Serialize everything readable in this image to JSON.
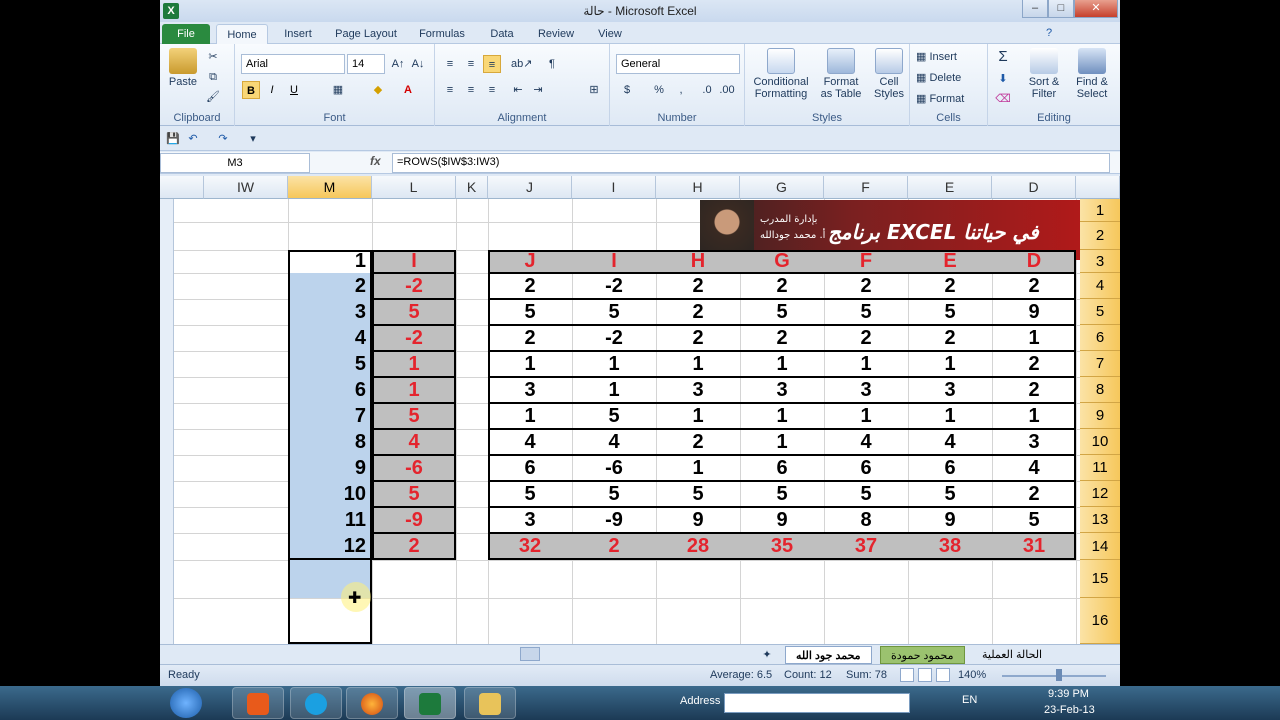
{
  "window": {
    "title": "حالة - Microsoft Excel",
    "app_icon": "X",
    "min_label": "–",
    "max_label": "□",
    "close_label": "✕"
  },
  "tabs": [
    "File",
    "Home",
    "Insert",
    "Page Layout",
    "Formulas",
    "Data",
    "Review",
    "View"
  ],
  "ribbon": {
    "clipboard": {
      "label": "Clipboard",
      "paste": "Paste"
    },
    "font": {
      "label": "Font",
      "name": "Arial",
      "size": "14",
      "bold": "B",
      "italic": "I",
      "underline": "U"
    },
    "alignment": {
      "label": "Alignment"
    },
    "number": {
      "label": "Number",
      "format": "General",
      "currency": "$",
      "percent": "%",
      "comma": ","
    },
    "styles": {
      "label": "Styles",
      "conditional": [
        "Conditional",
        "Formatting"
      ],
      "format_table": [
        "Format",
        "as Table"
      ],
      "cell_styles": [
        "Cell",
        "Styles"
      ]
    },
    "cells": {
      "label": "Cells",
      "insert": "Insert",
      "delete": "Delete",
      "format": "Format"
    },
    "editing": {
      "label": "Editing",
      "sort": [
        "Sort &",
        "Filter"
      ],
      "find": [
        "Find &",
        "Select"
      ]
    }
  },
  "formula_bar": {
    "name_box": "M3",
    "fx": "fx",
    "formula": "=ROWS($IW$3:IW3)"
  },
  "columns": [
    "IW",
    "M",
    "L",
    "K",
    "J",
    "I",
    "H",
    "G",
    "F",
    "E",
    "D"
  ],
  "rows": [
    "1",
    "2",
    "3",
    "4",
    "5",
    "6",
    "7",
    "8",
    "9",
    "10",
    "11",
    "12",
    "13",
    "14",
    "15",
    "16"
  ],
  "banner_text": "برنامج EXCEL في حياتنا",
  "banner_sub": "بإدارة المدرب",
  "banner_name": "أ. محمد جودالله",
  "table": {
    "headers": [
      "J",
      "I",
      "H",
      "G",
      "F",
      "E",
      "D"
    ],
    "data": [
      [
        "2",
        "-2",
        "2",
        "2",
        "2",
        "2",
        "2"
      ],
      [
        "5",
        "5",
        "2",
        "5",
        "5",
        "5",
        "9"
      ],
      [
        "2",
        "-2",
        "2",
        "2",
        "2",
        "2",
        "1"
      ],
      [
        "1",
        "1",
        "1",
        "1",
        "1",
        "1",
        "2"
      ],
      [
        "3",
        "1",
        "3",
        "3",
        "3",
        "3",
        "2"
      ],
      [
        "1",
        "5",
        "1",
        "1",
        "1",
        "1",
        "1"
      ],
      [
        "4",
        "4",
        "2",
        "1",
        "4",
        "4",
        "3"
      ],
      [
        "6",
        "-6",
        "1",
        "6",
        "6",
        "6",
        "4"
      ],
      [
        "5",
        "5",
        "5",
        "5",
        "5",
        "5",
        "2"
      ],
      [
        "3",
        "-9",
        "9",
        "9",
        "8",
        "9",
        "5"
      ]
    ],
    "totals": [
      "32",
      "2",
      "28",
      "35",
      "37",
      "38",
      "31"
    ]
  },
  "col_m": [
    "1",
    "2",
    "3",
    "4",
    "5",
    "6",
    "7",
    "8",
    "9",
    "10",
    "11",
    "12"
  ],
  "col_l": [
    "I",
    "-2",
    "5",
    "-2",
    "1",
    "1",
    "5",
    "4",
    "-6",
    "5",
    "-9",
    "2"
  ],
  "sheet_tabs": [
    "محمد جود الله",
    "محمود حمودة",
    "الحالة العملية"
  ],
  "status": {
    "ready": "Ready",
    "average": "Average: 6.5",
    "count": "Count: 12",
    "sum": "Sum: 78",
    "zoom": "140%"
  },
  "taskbar": {
    "address_label": "Address",
    "lang": "EN",
    "time": "9:39 PM",
    "date": "23-Feb-13"
  },
  "colors": {
    "red": "#e4242d",
    "header_gold": "#f6c75b",
    "selection_blue": "#bcd3ec",
    "gray_fill": "#bfbfbf"
  }
}
